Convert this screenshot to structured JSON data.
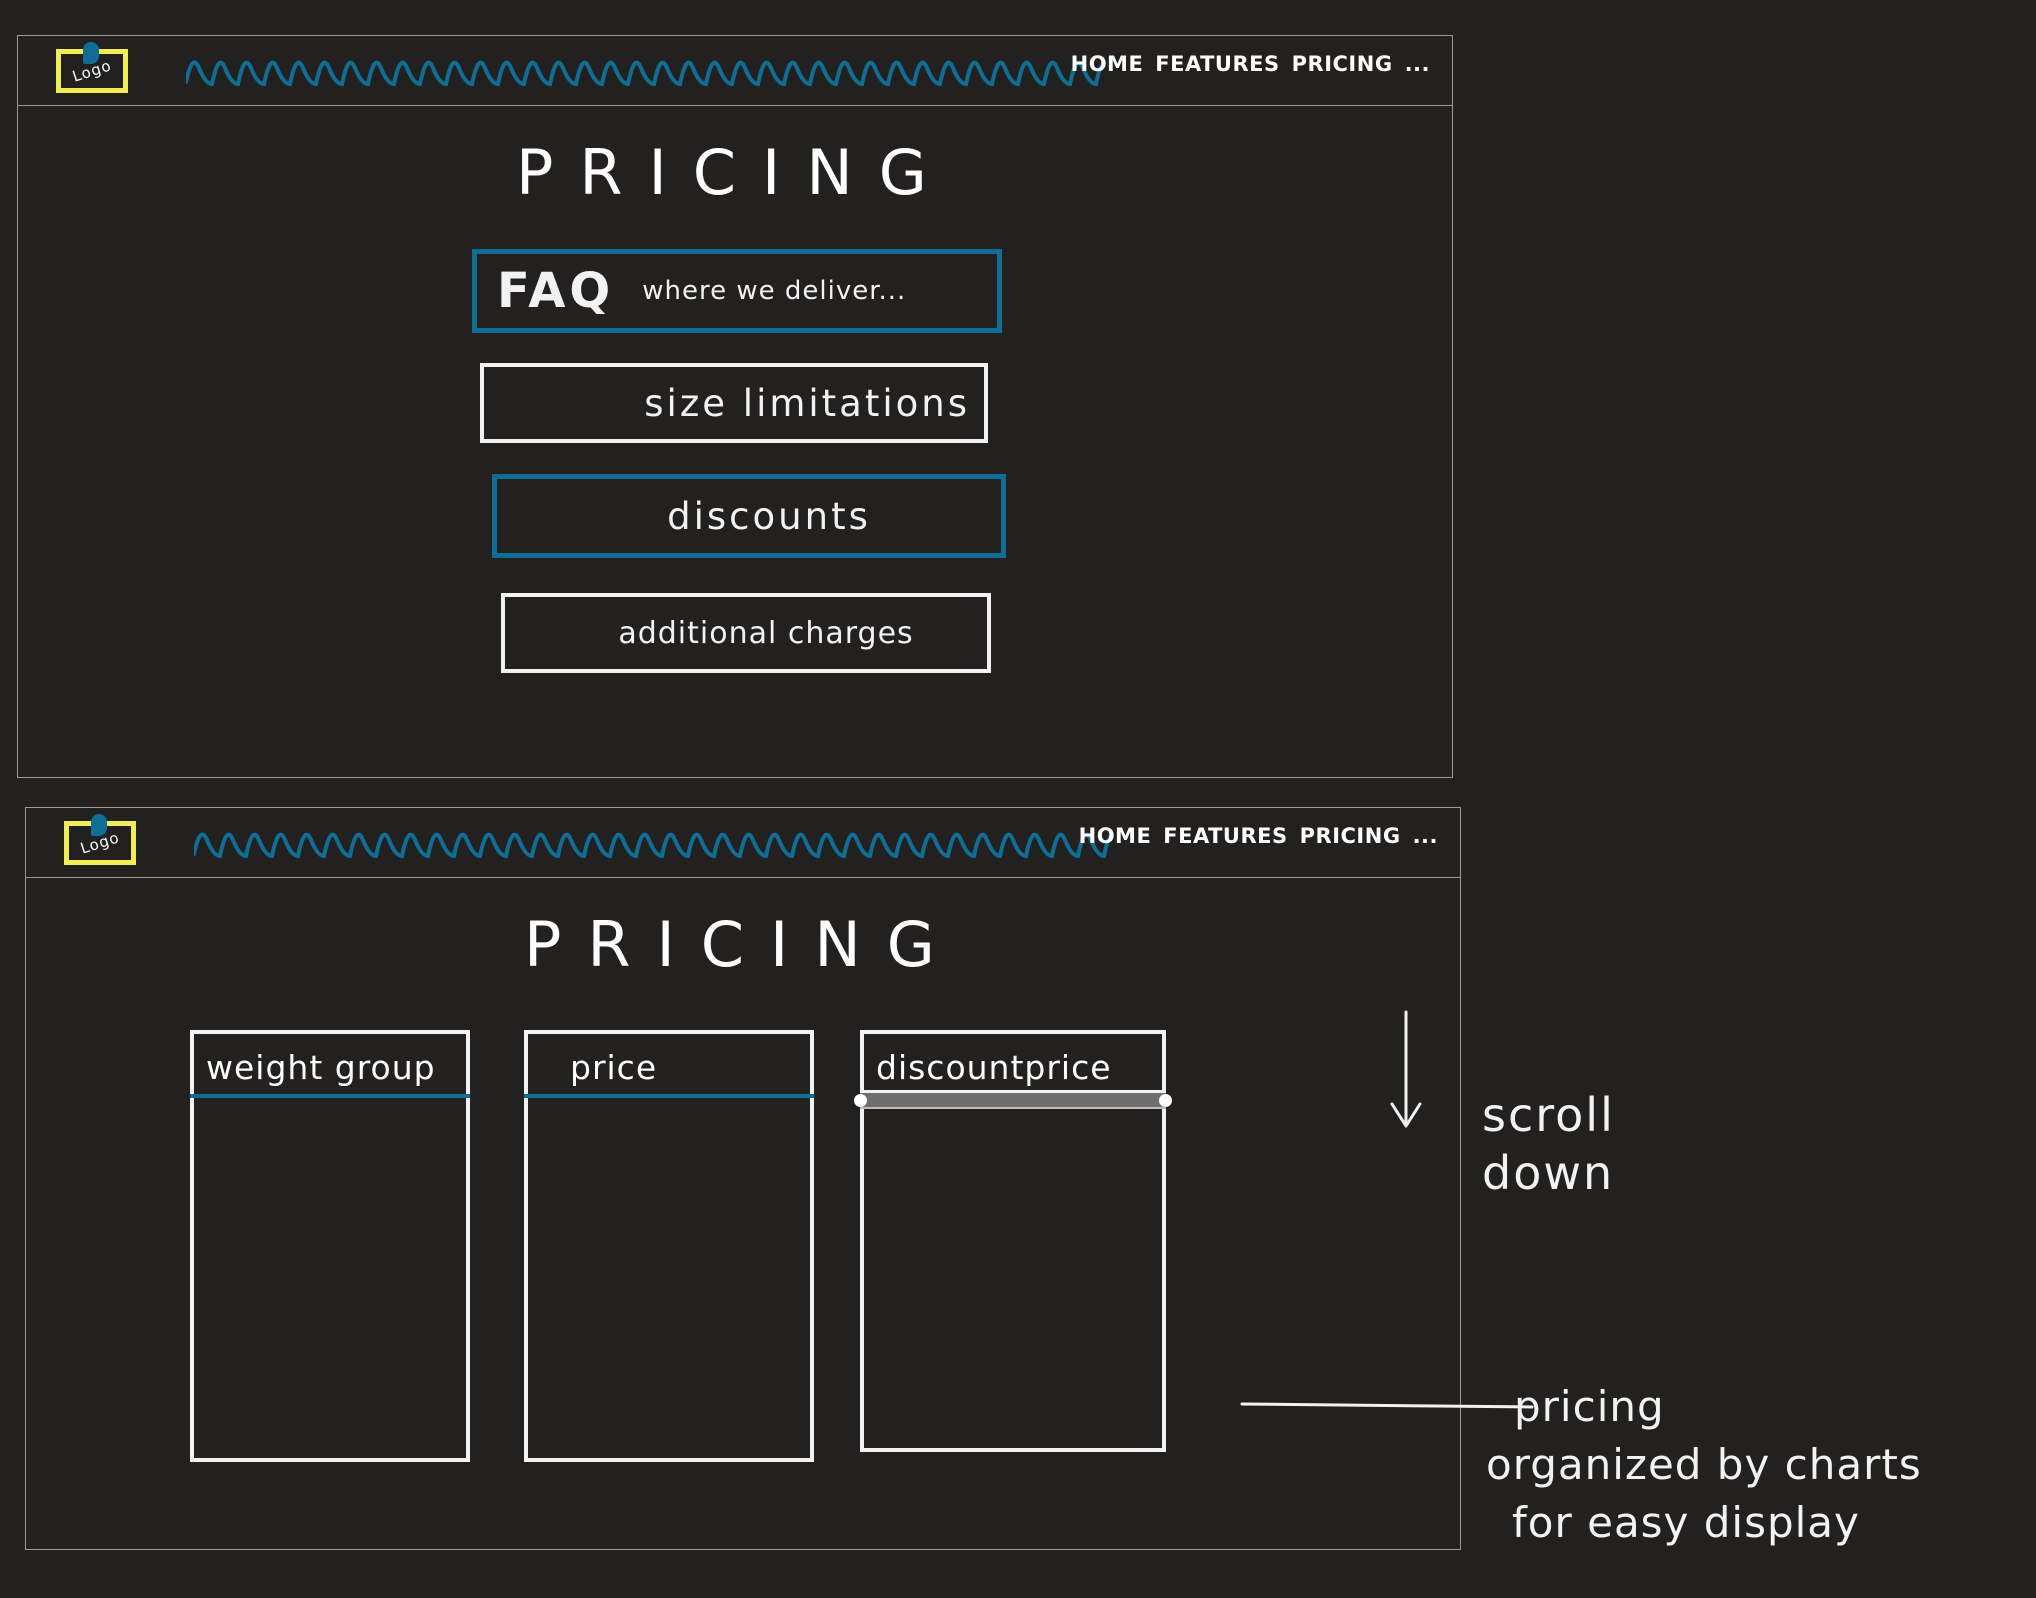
{
  "colors": {
    "background": "#222120",
    "accent_blue": "#0f6e96",
    "logo_yellow": "#f1f04d",
    "frame_gray": "#9a9a9a",
    "ink": "#f2f2f2"
  },
  "wireframe_top": {
    "logo": "Logo",
    "nav": [
      "HOME",
      "FEATURES",
      "PRICING",
      "..."
    ],
    "title": "PRICING",
    "faq": {
      "label": "FAQ",
      "subtext": "where we deliver..."
    },
    "boxes": [
      "size limitations",
      "discounts",
      "additional charges"
    ]
  },
  "wireframe_bottom": {
    "logo": "Logo",
    "nav": [
      "HOME",
      "FEATURES",
      "PRICING",
      "..."
    ],
    "title": "PRICING",
    "columns": [
      "weight group",
      "price",
      "discountprice"
    ]
  },
  "annotations": {
    "scroll": [
      "scroll",
      "down"
    ],
    "pricing_note": [
      "pricing",
      "organized by charts",
      "for easy display"
    ]
  }
}
